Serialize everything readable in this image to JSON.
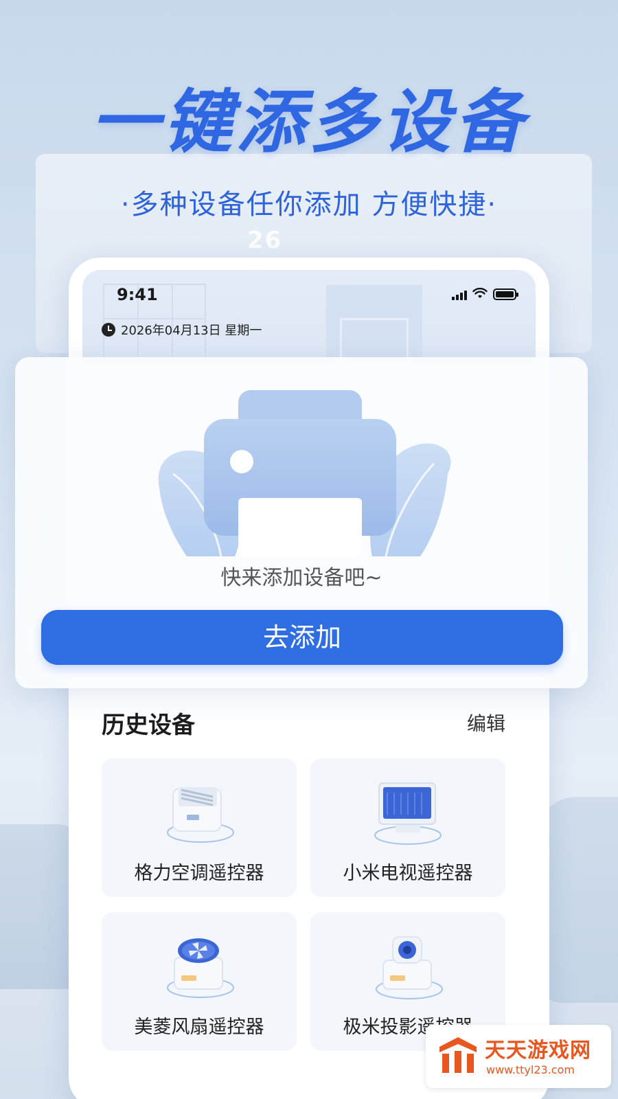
{
  "promo": {
    "headline": "一键添多设备",
    "subline": "·多种设备任你添加 方便快捷·",
    "background_display_temp": "26"
  },
  "status_bar": {
    "time": "9:41",
    "date": "2026年04月13日  星期一"
  },
  "add_card": {
    "hint": "快来添加设备吧~",
    "button_label": "去添加"
  },
  "history": {
    "title": "历史设备",
    "edit_label": "编辑",
    "devices": [
      {
        "label": "格力空调遥控器",
        "icon": "air-conditioner-icon"
      },
      {
        "label": "小米电视遥控器",
        "icon": "tv-icon"
      },
      {
        "label": "美菱风扇遥控器",
        "icon": "fan-icon"
      },
      {
        "label": "极米投影遥控器",
        "icon": "projector-icon"
      }
    ]
  },
  "watermark": {
    "name": "天天游戏网",
    "url": "www.ttyl23.com"
  },
  "colors": {
    "accent": "#2f6de3",
    "headline": "#2f67e3",
    "watermark": "#e8571f"
  }
}
